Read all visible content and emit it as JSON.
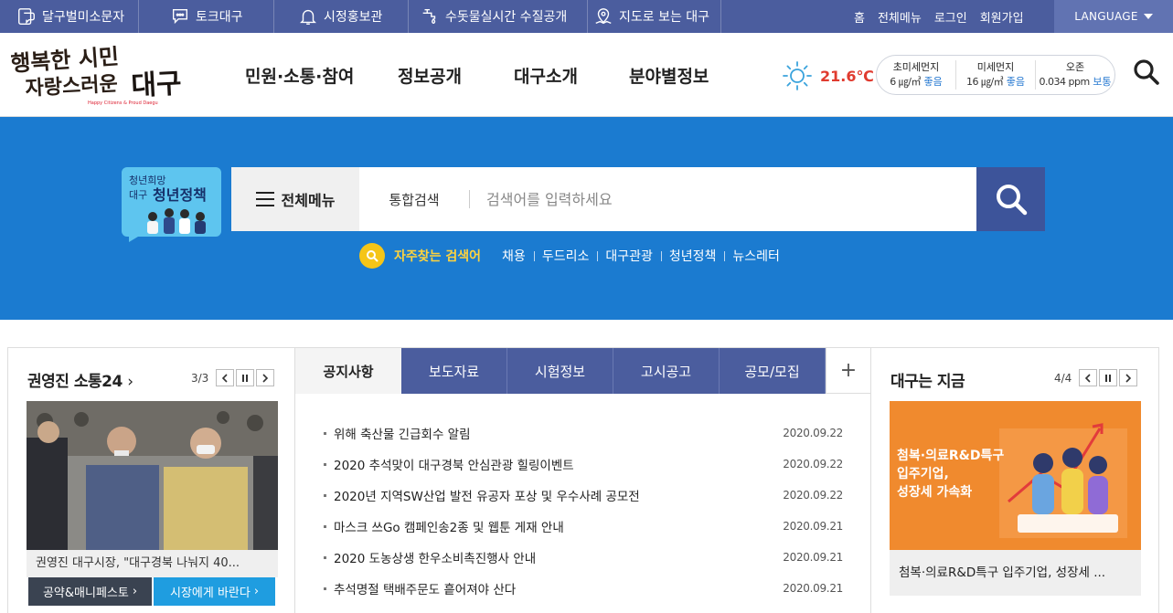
{
  "topbar": {
    "items": [
      {
        "label": "달구벌미소문자",
        "icon": "chat-phone-icon"
      },
      {
        "label": "토크대구",
        "icon": "speech-bubble-icon"
      },
      {
        "label": "시정홍보관",
        "icon": "bell-icon"
      },
      {
        "label": "수돗물실시간 수질공개",
        "icon": "water-tap-icon"
      },
      {
        "label": "지도로 보는 대구",
        "icon": "map-pin-icon"
      }
    ],
    "links": [
      "홈",
      "전체메뉴",
      "로그인",
      "회원가입"
    ],
    "language": "LANGUAGE"
  },
  "header": {
    "logo_text": "행복한 시민 자랑스러운 대구",
    "logo_sub": "Happy Citizens & Proud Daegu",
    "nav": [
      "민원·소통·참여",
      "정보공개",
      "대구소개",
      "분야별정보"
    ],
    "temperature": "21.6℃",
    "air": [
      {
        "title": "초미세먼지",
        "value": "6 ㎍/㎥",
        "status": "좋음"
      },
      {
        "title": "미세먼지",
        "value": "16 ㎍/㎥",
        "status": "좋음"
      },
      {
        "title": "오존",
        "value": "0.034 ppm",
        "status": "보통"
      }
    ]
  },
  "search": {
    "banner_line1": "청년희망",
    "banner_line2": "대구",
    "banner_line3": "청년정책",
    "all_menu": "전체메뉴",
    "scope": "통합검색",
    "placeholder": "검색어를 입력하세요",
    "popular_title": "자주찾는 검색어",
    "popular": [
      "채용",
      "두드리소",
      "대구관광",
      "청년정책",
      "뉴스레터"
    ]
  },
  "left_panel": {
    "title": "권영진 소통24",
    "counter": "3/3",
    "caption": "권영진 대구시장, \"대구경북 나눠지 40...",
    "btn1": "공약&매니페스토",
    "btn2": "시장에게 바란다"
  },
  "notice": {
    "tabs": [
      "공지사항",
      "보도자료",
      "시험정보",
      "고시공고",
      "공모/모집"
    ],
    "items": [
      {
        "title": "위해 축산물 긴급회수 알림",
        "date": "2020.09.22"
      },
      {
        "title": "2020 추석맞이 대구경북 안심관광 힐링이벤트",
        "date": "2020.09.22"
      },
      {
        "title": "2020년 지역SW산업 발전 유공자 포상 및 우수사례 공모전",
        "date": "2020.09.22"
      },
      {
        "title": "마스크 쓰Go 캠페인송2종 및 웹툰 게재 안내",
        "date": "2020.09.21"
      },
      {
        "title": "2020 도농상생 한우소비촉진행사 안내",
        "date": "2020.09.21"
      },
      {
        "title": "추석명절 택배주문도 흩어져야 산다",
        "date": "2020.09.21"
      }
    ]
  },
  "right_panel": {
    "title": "대구는 지금",
    "counter": "4/4",
    "image_text_1": "첨복·의료R&D특구",
    "image_text_2": "입주기업,",
    "image_text_3": "성장세 가속화",
    "caption": "첨복·의료R&D특구 입주기업, 성장세 ..."
  },
  "colors": {
    "topbar": "#4b5d9e",
    "search_bg": "#1b7bd0",
    "temp": "#e03b2f",
    "popular_title": "#ffd33d",
    "promo_orange": "#f08a2e"
  }
}
